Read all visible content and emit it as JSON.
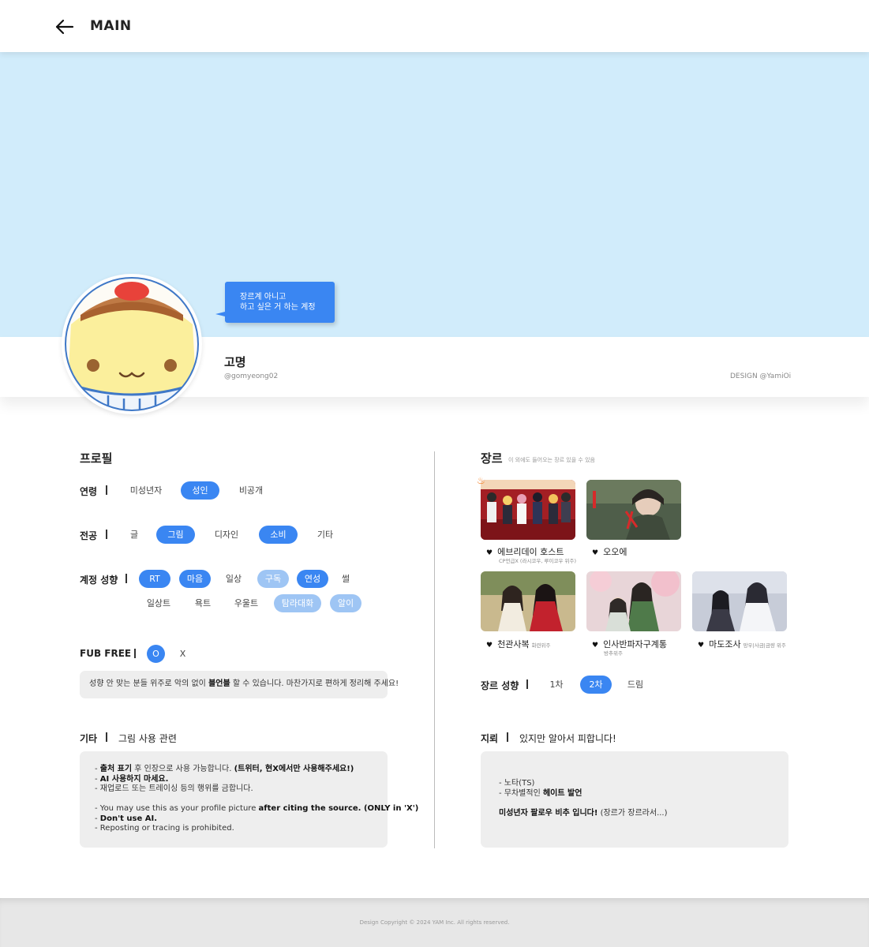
{
  "header": {
    "title": "MAIN"
  },
  "profile_header": {
    "bubble_lines": [
      "장르계 아니고",
      "하고 싶은 거 하는 계정"
    ],
    "name": "고명",
    "handle": "@gomyeong02",
    "design_credit": "DESIGN @YamiOi"
  },
  "profile": {
    "title": "프로필",
    "age": {
      "label": "연령",
      "options": [
        "미성년자",
        "성인",
        "비공개"
      ],
      "selected": "성인"
    },
    "major": {
      "label": "전공",
      "options": [
        "글",
        "그림",
        "디자인",
        "소비",
        "기타"
      ],
      "selected": [
        "그림",
        "소비"
      ]
    },
    "tendency": {
      "label": "계정 성향",
      "options": [
        "RT",
        "마음",
        "일상",
        "구독",
        "연성",
        "썰",
        "일상트",
        "욕트",
        "우울트",
        "탐라대화",
        "알이"
      ],
      "selected": [
        "RT",
        "마음",
        "연성"
      ],
      "partial": [
        "구독",
        "탐라대화",
        "알이"
      ]
    },
    "fub_free": {
      "label": "FUB FREE",
      "options": [
        "O",
        "X"
      ],
      "selected": "O",
      "note_before": "성향 안 맞는 분들 위주로 악의 없이 ",
      "note_bold": "블언블",
      "note_after": " 할 수 있습니다. 마찬가지로 편하게 정리해 주세요!"
    },
    "etc": {
      "label": "기타",
      "value": "그림 사용 관련",
      "lines": [
        {
          "a": "- ",
          "b": "출처 표기",
          "c": " 후 인장으로 사용 가능합니다. ",
          "d": "(트위터, 현X에서만 사용해주세요!)"
        },
        {
          "a": "- ",
          "b": "AI 사용하지 마세요.",
          "c": "",
          "d": ""
        },
        {
          "a": "- 재업로드 또는 트레이싱 등의 행위를 금합니다.",
          "b": "",
          "c": "",
          "d": ""
        },
        {
          "a": "- You may use this as your profile picture ",
          "b": "after citing the source. (ONLY in 'X')",
          "c": "",
          "d": ""
        },
        {
          "a": "- ",
          "b": "Don't use AI.",
          "c": "",
          "d": ""
        },
        {
          "a": "- Reposting or tracing is prohibited.",
          "b": "",
          "c": "",
          "d": ""
        }
      ]
    }
  },
  "genre": {
    "title": "장르",
    "note": "이 외에도 들어오는 장르 있을 수 있음",
    "items": [
      {
        "title": "에브리데이 호스트",
        "sub": "",
        "sub2": "CP언급X (라시코우, 루이코우 위주)"
      },
      {
        "title": "오오에",
        "sub": "",
        "sub2": ""
      },
      {
        "title": "천관사복",
        "sub": "화련위주",
        "sub2": ""
      },
      {
        "title": "인사반파자구계통",
        "sub": "",
        "sub2": "방추위주"
      },
      {
        "title": "마도조사",
        "sub": "망우|사금|금량 위주",
        "sub2": ""
      }
    ],
    "tendency": {
      "label": "장르 성향",
      "options": [
        "1차",
        "2차",
        "드림"
      ],
      "selected": "2차"
    },
    "trigger": {
      "label": "지뢰",
      "value": "있지만 알아서 피합니다!",
      "line1": "- 노타(TS)",
      "line2_a": "- 무차별적인 ",
      "line2_b": "헤이트 발언",
      "line3_b": "미성년자 팔로우 비추 입니다!",
      "line3_c": " (장르가 장르라서...)"
    }
  },
  "footer": {
    "copyright": "Design Copyright © 2024 YAM Inc. All rights reserved."
  },
  "colors": {
    "accent": "#3a86f2",
    "accent_soft": "#9ec5f4",
    "banner": "#d1ecfb"
  }
}
